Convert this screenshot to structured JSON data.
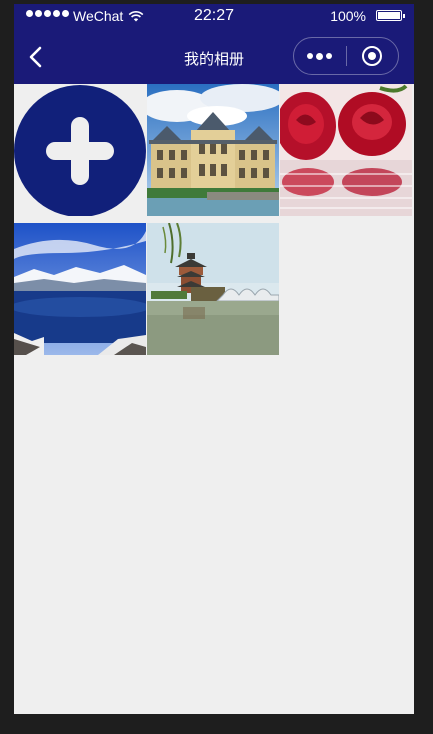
{
  "status_bar": {
    "carrier": "WeChat",
    "time": "22:27",
    "battery": "100%"
  },
  "nav": {
    "title": "我的相册",
    "back_icon": "chevron-left-icon",
    "more_icon": "more-dots-icon",
    "close_icon": "target-circle-icon"
  },
  "colors": {
    "header_bg": "#1a1a78",
    "add_button_bg": "#11207a",
    "page_bg": "#efefef"
  },
  "album": {
    "add_icon": "plus-icon",
    "photos": [
      {
        "subject": "castle"
      },
      {
        "subject": "red roses"
      },
      {
        "subject": "crater lake"
      },
      {
        "subject": "pagoda and bridge"
      }
    ]
  }
}
